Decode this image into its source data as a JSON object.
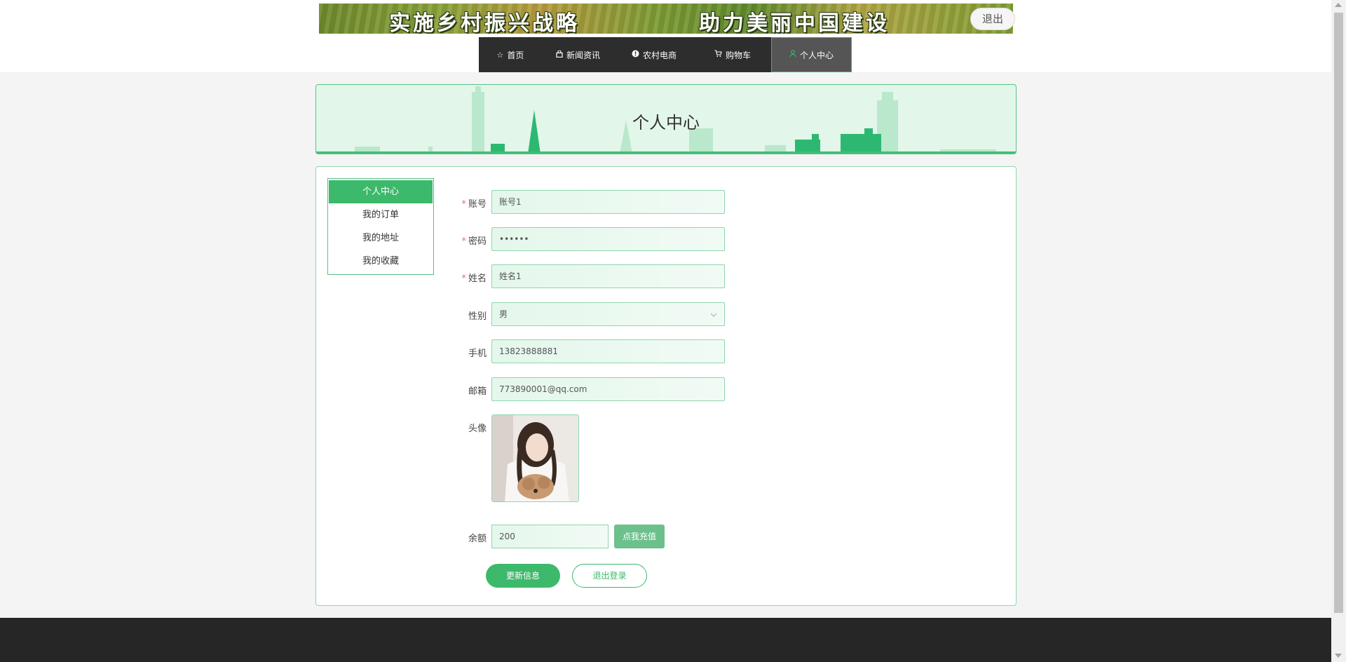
{
  "banner": {
    "text_left": "实施乡村振兴战略",
    "text_right": "助力美丽中国建设",
    "logout": "退出"
  },
  "nav": [
    {
      "icon": "star-icon",
      "label": "首页"
    },
    {
      "icon": "bag-icon",
      "label": "新闻资讯"
    },
    {
      "icon": "info-icon",
      "label": "农村电商"
    },
    {
      "icon": "cart-icon",
      "label": "购物车"
    },
    {
      "icon": "user-icon",
      "label": "个人中心",
      "active": true
    }
  ],
  "hero": {
    "title": "个人中心"
  },
  "sidebar": {
    "items": [
      {
        "label": "个人中心",
        "active": true
      },
      {
        "label": "我的订单"
      },
      {
        "label": "我的地址"
      },
      {
        "label": "我的收藏"
      }
    ]
  },
  "form": {
    "account": {
      "label": "账号",
      "value": "账号1",
      "required": true
    },
    "password": {
      "label": "密码",
      "value": "••••••",
      "required": true
    },
    "name": {
      "label": "姓名",
      "value": "姓名1",
      "required": true
    },
    "gender": {
      "label": "性别",
      "value": "男"
    },
    "phone": {
      "label": "手机",
      "value": "13823888881"
    },
    "email": {
      "label": "邮箱",
      "value": "773890001@qq.com"
    },
    "avatar": {
      "label": "头像"
    },
    "balance": {
      "label": "余额",
      "value": "200",
      "recharge": "点我充值"
    },
    "update_button": "更新信息",
    "logout_button": "退出登录"
  },
  "colors": {
    "accent": "#3cb96b",
    "nav_bg": "#2d2d2d",
    "footer_bg": "#262626"
  }
}
